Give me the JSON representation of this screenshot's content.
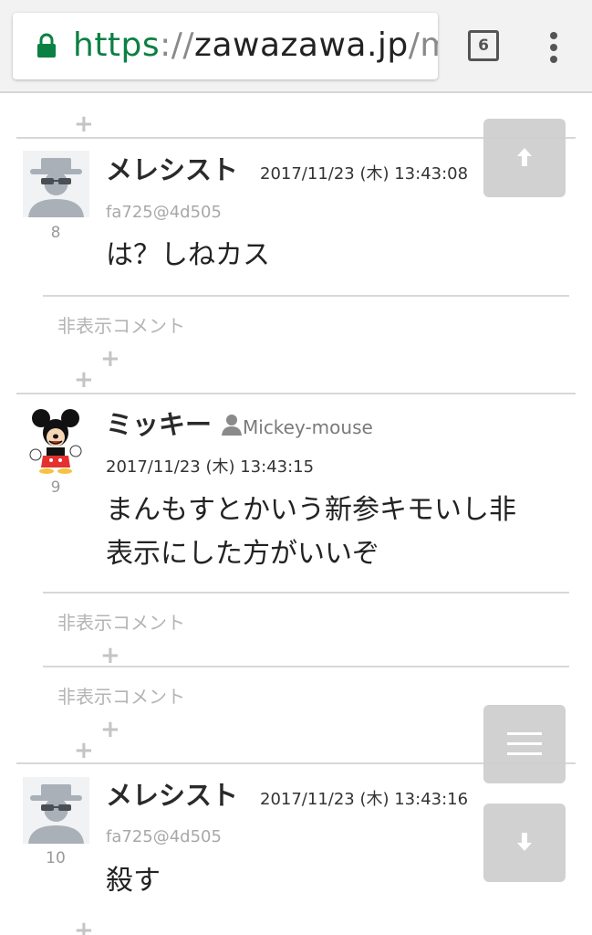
{
  "browser": {
    "url_scheme": "https",
    "url_sep": "://",
    "url_host": "zawazawa.jp",
    "url_path": "/m",
    "tab_count": "6"
  },
  "comments": [
    {
      "name": "メレシスト",
      "date": "2017/11/23 (木) 13:43:08",
      "uid": "fa725@4d505",
      "number": "8",
      "body": "は？しねカス",
      "avatar": "anonymous-avatar-icon"
    },
    {
      "name": "ミッキー",
      "handle": "Mickey-mouse",
      "date": "2017/11/23 (木) 13:43:15",
      "number": "9",
      "body_line1": "まんもすとかいう新参キモいし非",
      "body_line2": "表示にした方がいいぞ",
      "avatar": "mickey-mouse-avatar"
    },
    {
      "name": "メレシスト",
      "date": "2017/11/23 (木) 13:43:16",
      "uid": "fa725@4d505",
      "number": "10",
      "body": "殺す",
      "avatar": "anonymous-avatar-icon"
    }
  ],
  "hidden_comment_label": "非表示コメント",
  "plus_symbol": "+",
  "fab": {
    "up": "arrow-up-icon",
    "menu": "hamburger-menu-icon",
    "down": "arrow-down-icon"
  }
}
